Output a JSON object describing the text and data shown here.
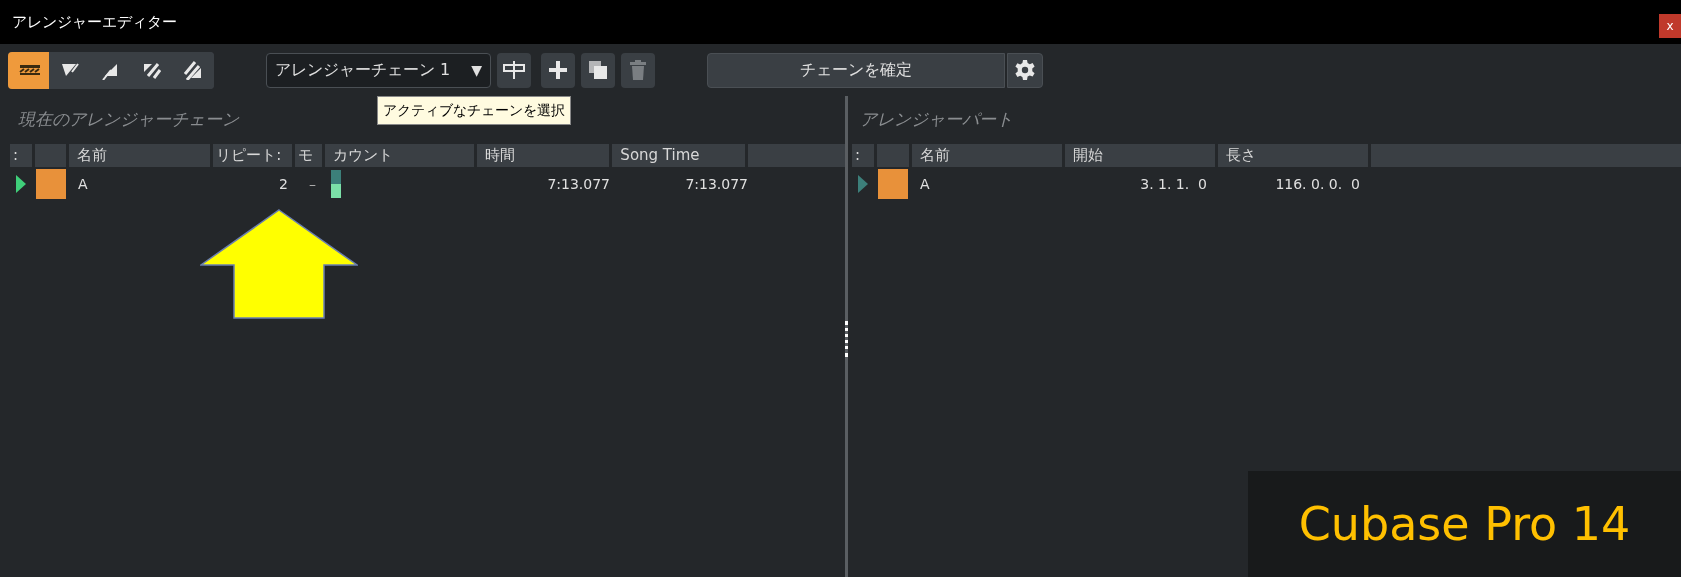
{
  "window": {
    "title": "アレンジャーエディター",
    "close": "x"
  },
  "toolbar": {
    "modes": [
      {
        "selected": true
      },
      {
        "selected": false
      },
      {
        "selected": false
      },
      {
        "selected": false
      },
      {
        "selected": false
      }
    ],
    "chain_select": {
      "value": "アレンジャーチェーン 1",
      "arrow": "▼"
    },
    "tooltip": "アクティブなチェーンを選択",
    "actions": [
      {
        "kind": "split",
        "disabled": false
      },
      {
        "kind": "add",
        "disabled": false
      },
      {
        "kind": "duplicate",
        "disabled": false
      },
      {
        "kind": "delete",
        "disabled": true
      }
    ],
    "confirm_button": "チェーンを確定"
  },
  "chain_panel": {
    "title": "現在のアレンジャーチェーン",
    "columns": [
      ":",
      "",
      "名前",
      "リピート:",
      "モ",
      "カウント",
      "時間",
      "Song Time",
      ""
    ],
    "rows": [
      {
        "playing": true,
        "color": "#e8913a",
        "name": "A",
        "repeat": "2",
        "mode": "–",
        "level": 0.5,
        "time": "7:13.077",
        "song_time": "7:13.077"
      }
    ]
  },
  "parts_panel": {
    "title": "アレンジャーパート",
    "columns": [
      ":",
      "",
      "名前",
      "開始",
      "長さ",
      ""
    ],
    "rows": [
      {
        "playing": false,
        "color": "#e8913a",
        "name": "A",
        "start": "3. 1. 1.  0",
        "length": "116. 0. 0.  0"
      }
    ]
  },
  "caption": "Cubase Pro 14"
}
